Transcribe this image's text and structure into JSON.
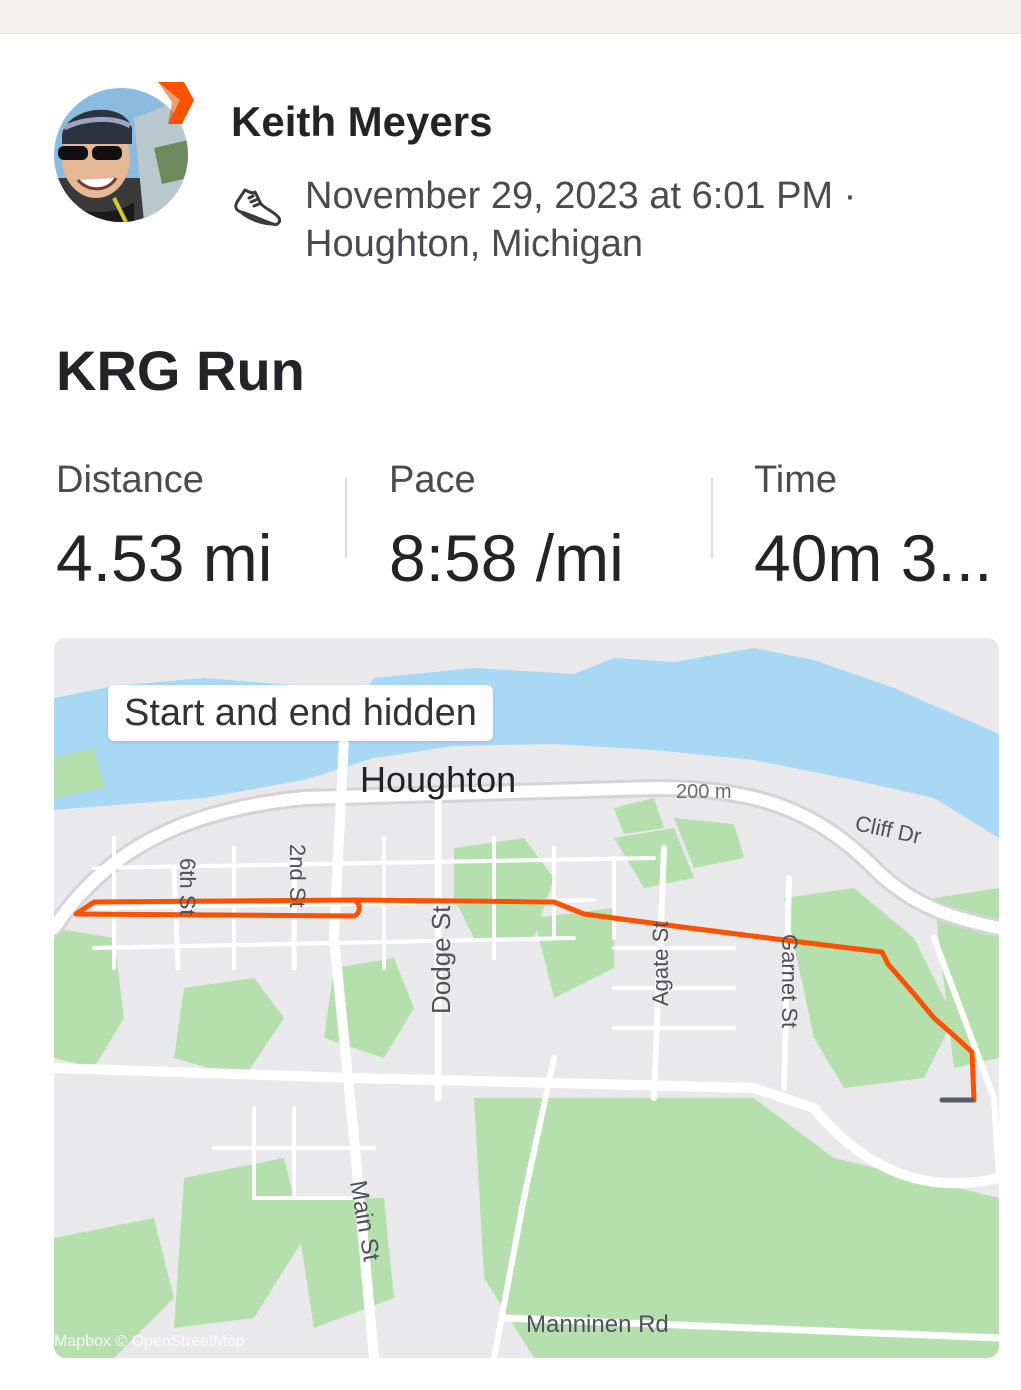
{
  "athlete": {
    "name": "Keith Meyers",
    "date_line": "November 29, 2023 at 6:01 PM ·",
    "location_line": "Houghton, Michigan"
  },
  "activity": {
    "title": "KRG Run"
  },
  "stats": [
    {
      "label": "Distance",
      "value": "4.53 mi"
    },
    {
      "label": "Pace",
      "value": "8:58 /mi"
    },
    {
      "label": "Time",
      "value": "40m 3..."
    }
  ],
  "map": {
    "privacy_badge": "Start and end hidden",
    "city_label": "Houghton",
    "scale_label": "200 m",
    "streets": {
      "cliff": "Cliff Dr",
      "sixth": "6th St",
      "second": "2nd St",
      "dodge": "Dodge St",
      "agate": "Agate St",
      "garnet": "Garnet St",
      "main": "Main St",
      "manninen": "Manninen Rd"
    },
    "attribution": "Mapbox © OpenStreetMap",
    "colors": {
      "route": "#fc5200",
      "water": "#a9d8f5",
      "park": "#b5e0ae",
      "land": "#e9e9ec",
      "road": "#ffffff"
    }
  },
  "brand": {
    "accent": "#fc5200"
  },
  "icons": {
    "avatar_badge": "strava-subscriber-badge-icon",
    "activity_type": "running-shoe-icon"
  }
}
